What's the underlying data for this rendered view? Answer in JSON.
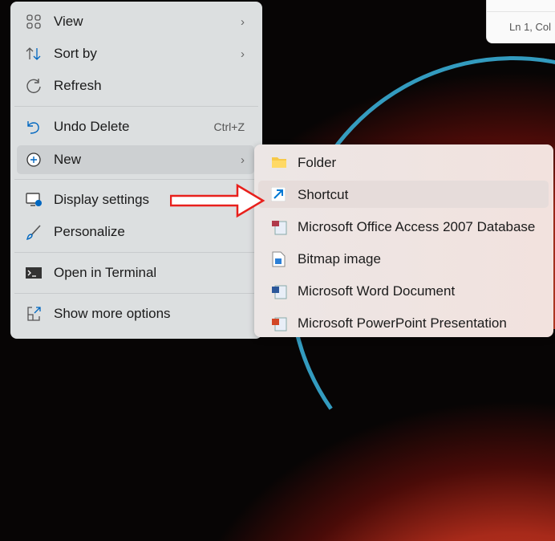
{
  "notepad": {
    "status": "Ln 1, Col"
  },
  "menu": {
    "items": [
      {
        "label": "View",
        "icon": "grid-icon",
        "chevron": true
      },
      {
        "label": "Sort by",
        "icon": "sort-icon",
        "chevron": true
      },
      {
        "label": "Refresh",
        "icon": "refresh-icon"
      },
      {
        "label": "Undo Delete",
        "icon": "undo-icon",
        "shortcut": "Ctrl+Z"
      },
      {
        "label": "New",
        "icon": "plus-circle-icon",
        "chevron": true
      },
      {
        "label": "Display settings",
        "icon": "display-settings-icon"
      },
      {
        "label": "Personalize",
        "icon": "brush-icon"
      },
      {
        "label": "Open in Terminal",
        "icon": "terminal-icon"
      },
      {
        "label": "Show more options",
        "icon": "more-options-icon"
      }
    ]
  },
  "submenu": {
    "items": [
      {
        "label": "Folder",
        "icon": "folder-icon"
      },
      {
        "label": "Shortcut",
        "icon": "shortcut-icon"
      },
      {
        "label": "Microsoft Office Access 2007 Database",
        "icon": "access-icon"
      },
      {
        "label": "Bitmap image",
        "icon": "bitmap-icon"
      },
      {
        "label": "Microsoft Word Document",
        "icon": "word-icon"
      },
      {
        "label": "Microsoft PowerPoint Presentation",
        "icon": "powerpoint-icon"
      }
    ]
  },
  "colors": {
    "accent": "#0067c0",
    "arrow": "#e8201c"
  }
}
